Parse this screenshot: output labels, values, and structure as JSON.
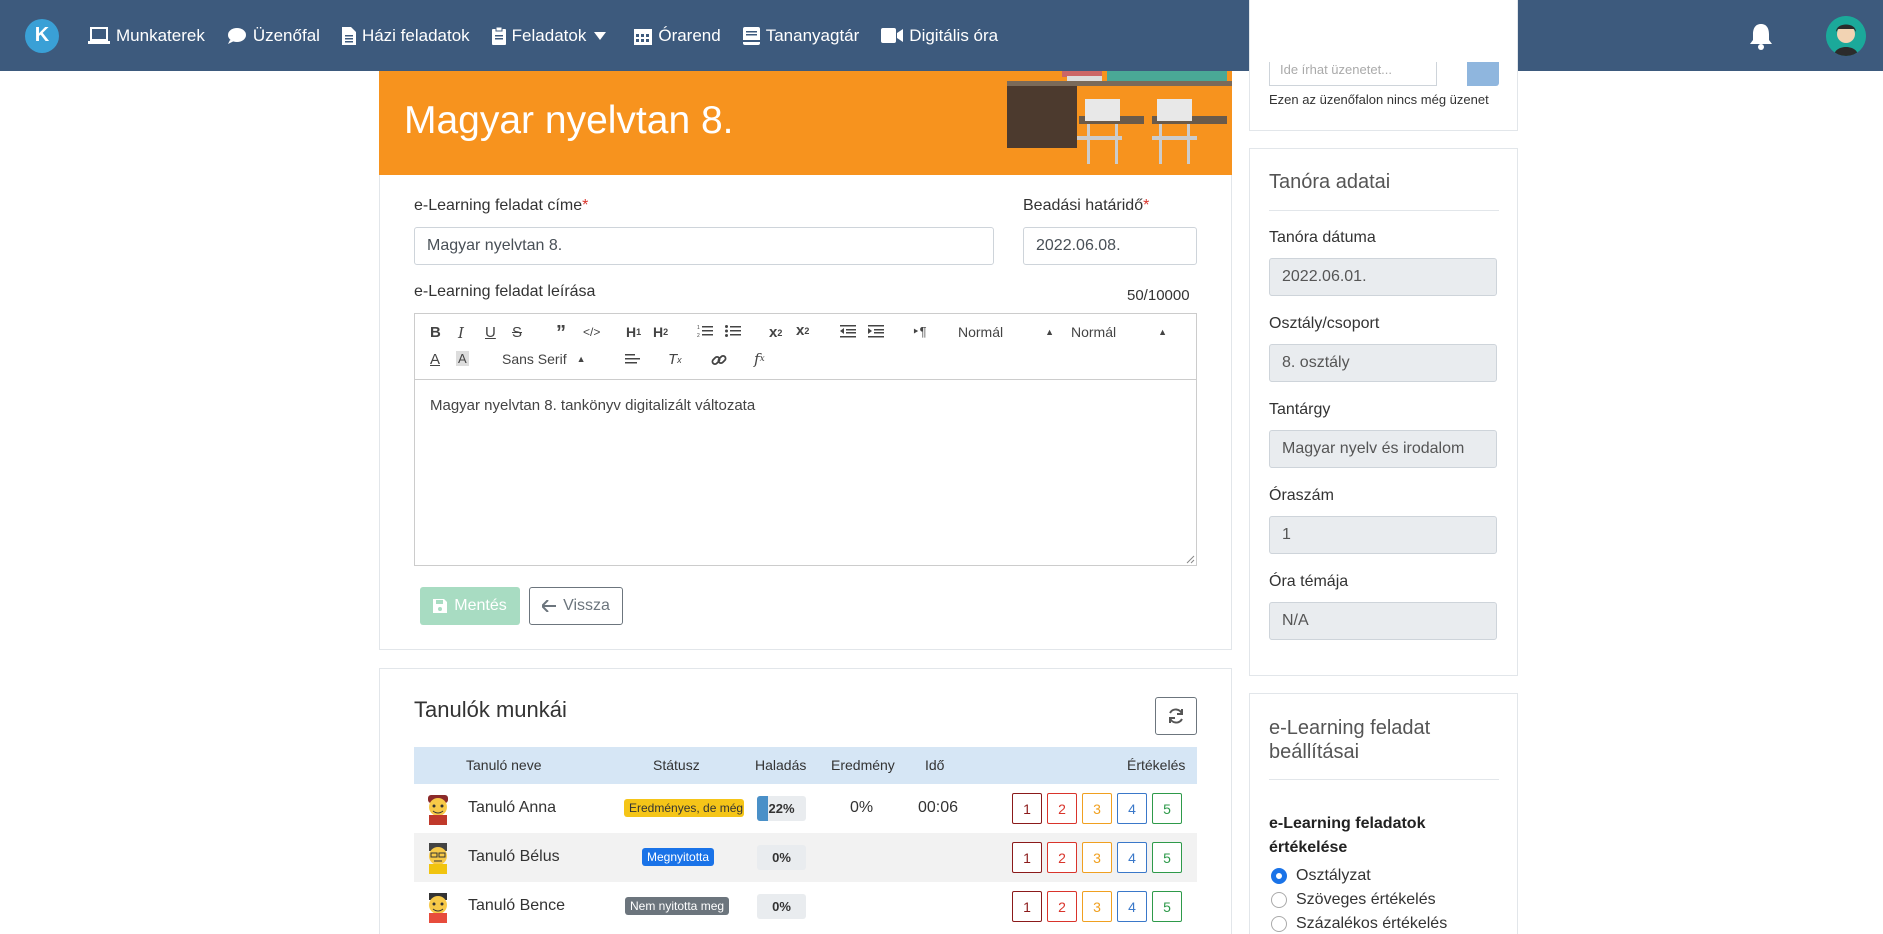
{
  "nav": {
    "logo_letter": "K",
    "items": [
      {
        "label": "Munkaterek",
        "icon": "laptop-icon"
      },
      {
        "label": "Üzenőfal",
        "icon": "comment-icon"
      },
      {
        "label": "Házi feladatok",
        "icon": "file-icon"
      },
      {
        "label": "Feladatok",
        "icon": "clipboard-icon"
      },
      {
        "label": "Órarend",
        "icon": "calendar-icon"
      },
      {
        "label": "Tananyagtár",
        "icon": "book-icon"
      },
      {
        "label": "Digitális óra",
        "icon": "video-icon"
      }
    ]
  },
  "banner": {
    "title": "Magyar nyelvtan 8."
  },
  "form": {
    "title_label": "e-Learning feladat címe",
    "title_value": "Magyar nyelvtan 8.",
    "deadline_label": "Beadási határidő",
    "deadline_value": "2022.06.08.",
    "required_mark": "*",
    "desc_label": "e-Learning feladat leírása",
    "counter": "50/10000",
    "desc_value": "Magyar nyelvtan 8. tankönyv digitalizált változata",
    "toolbar": {
      "header_select": "Normál",
      "size_select": "Normál",
      "font_select": "Sans Serif"
    },
    "save_label": "Mentés",
    "back_label": "Vissza"
  },
  "students": {
    "title": "Tanulók munkái",
    "headers": {
      "name": "Tanuló neve",
      "status": "Státusz",
      "progress": "Haladás",
      "result": "Eredmény",
      "time": "Idő",
      "grading": "Értékelés"
    },
    "rows": [
      {
        "name": "Tanuló Anna",
        "status": "Eredményes, de még f",
        "status_color": "#f5c518",
        "status_text_color": "#333333",
        "progress": 0.22,
        "progress_label": "22%",
        "result": "0%",
        "time": "00:06"
      },
      {
        "name": "Tanuló Bélus",
        "status": "Megnyitotta",
        "status_color": "#1a73e8",
        "status_text_color": "#ffffff",
        "progress": 0,
        "progress_label": "0%",
        "result": "",
        "time": ""
      },
      {
        "name": "Tanuló Bence",
        "status": "Nem nyitotta meg",
        "status_color": "#6c757d",
        "status_text_color": "#ffffff",
        "progress": 0,
        "progress_label": "0%",
        "result": "",
        "time": ""
      }
    ],
    "grades": [
      "1",
      "2",
      "3",
      "4",
      "5"
    ],
    "grade_colors": [
      "#8b1a1a",
      "#d9342b",
      "#f0a020",
      "#3a78c9",
      "#2e9a4a"
    ]
  },
  "sidebar": {
    "msg_placeholder": "Ide írhat üzenetet...",
    "msg_empty": "Ezen az üzenőfalon nincs még üzenet",
    "lesson": {
      "title": "Tanóra adatai",
      "fields": [
        {
          "label": "Tanóra dátuma",
          "value": "2022.06.01."
        },
        {
          "label": "Osztály/csoport",
          "value": "8. osztály"
        },
        {
          "label": "Tantárgy",
          "value": "Magyar nyelv és irodalom"
        },
        {
          "label": "Óraszám",
          "value": "1"
        },
        {
          "label": "Óra témája",
          "value": "N/A"
        }
      ]
    },
    "settings": {
      "title": "e-Learning feladat beállításai",
      "grading_label": "e-Learning feladatok értékelése",
      "options": [
        "Osztályzat",
        "Szöveges értékelés",
        "Százalékos értékelés"
      ],
      "selected": 0
    }
  }
}
